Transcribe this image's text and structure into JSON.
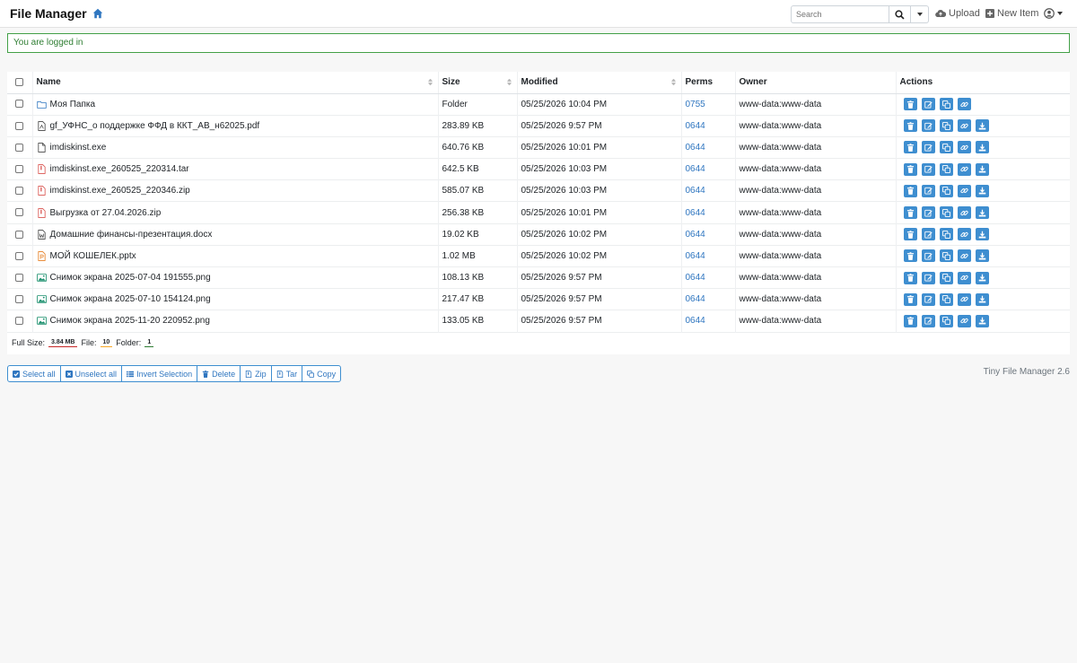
{
  "app": {
    "title": "File Manager",
    "version": "Tiny File Manager 2.6"
  },
  "search": {
    "placeholder": "Search"
  },
  "nav": {
    "upload": "Upload",
    "new_item": "New Item"
  },
  "alert": {
    "text": "You are logged in"
  },
  "table": {
    "headers": {
      "name": "Name",
      "size": "Size",
      "modified": "Modified",
      "perms": "Perms",
      "owner": "Owner",
      "actions": "Actions"
    },
    "rows": [
      {
        "name": "Моя Папка",
        "icon": "folder-icon",
        "size": "Folder",
        "modified": "05/25/2026 10:04 PM",
        "perms": "0755",
        "owner": "www-data:www-data"
      },
      {
        "name": "gf_УФНС_о поддержке ФФД в ККТ_АВ_н62025.pdf",
        "icon": "pdf-file-icon",
        "size": "283.89 KB",
        "modified": "05/25/2026 9:57 PM",
        "perms": "0644",
        "owner": "www-data:www-data"
      },
      {
        "name": "imdiskinst.exe",
        "icon": "file-icon",
        "size": "640.76 KB",
        "modified": "05/25/2026 10:01 PM",
        "perms": "0644",
        "owner": "www-data:www-data"
      },
      {
        "name": "imdiskinst.exe_260525_220314.tar",
        "icon": "archive-icon",
        "size": "642.5 KB",
        "modified": "05/25/2026 10:03 PM",
        "perms": "0644",
        "owner": "www-data:www-data"
      },
      {
        "name": "imdiskinst.exe_260525_220346.zip",
        "icon": "archive-icon",
        "size": "585.07 KB",
        "modified": "05/25/2026 10:03 PM",
        "perms": "0644",
        "owner": "www-data:www-data"
      },
      {
        "name": "Выгрузка от 27.04.2026.zip",
        "icon": "archive-icon",
        "size": "256.38 KB",
        "modified": "05/25/2026 10:01 PM",
        "perms": "0644",
        "owner": "www-data:www-data"
      },
      {
        "name": "Домашние финансы-презентация.docx",
        "icon": "word-file-icon",
        "size": "19.02 KB",
        "modified": "05/25/2026 10:02 PM",
        "perms": "0644",
        "owner": "www-data:www-data"
      },
      {
        "name": "МОЙ КОШЕЛЕК.pptx",
        "icon": "powerpoint-file-icon",
        "size": "1.02 MB",
        "modified": "05/25/2026 10:02 PM",
        "perms": "0644",
        "owner": "www-data:www-data"
      },
      {
        "name": "Снимок экрана 2025-07-04 191555.png",
        "icon": "image-file-icon",
        "size": "108.13 KB",
        "modified": "05/25/2026 9:57 PM",
        "perms": "0644",
        "owner": "www-data:www-data"
      },
      {
        "name": "Снимок экрана 2025-07-10 154124.png",
        "icon": "image-file-icon",
        "size": "217.47 KB",
        "modified": "05/25/2026 9:57 PM",
        "perms": "0644",
        "owner": "www-data:www-data"
      },
      {
        "name": "Снимок экрана 2025-11-20 220952.png",
        "icon": "image-file-icon",
        "size": "133.05 KB",
        "modified": "05/25/2026 9:57 PM",
        "perms": "0644",
        "owner": "www-data:www-data"
      }
    ]
  },
  "summary": {
    "full_size_label": "Full Size:",
    "full_size": "3.84 MB",
    "file_label": "File:",
    "file_count": "10",
    "folder_label": "Folder:",
    "folder_count": "1"
  },
  "toolbar": {
    "select_all": "Select all",
    "unselect_all": "Unselect all",
    "invert_selection": "Invert Selection",
    "delete": "Delete",
    "zip": "Zip",
    "tar": "Tar",
    "copy": "Copy"
  },
  "colors": {
    "accent": "#3e8ed0",
    "link": "#2f76c0",
    "success": "#43a047"
  }
}
